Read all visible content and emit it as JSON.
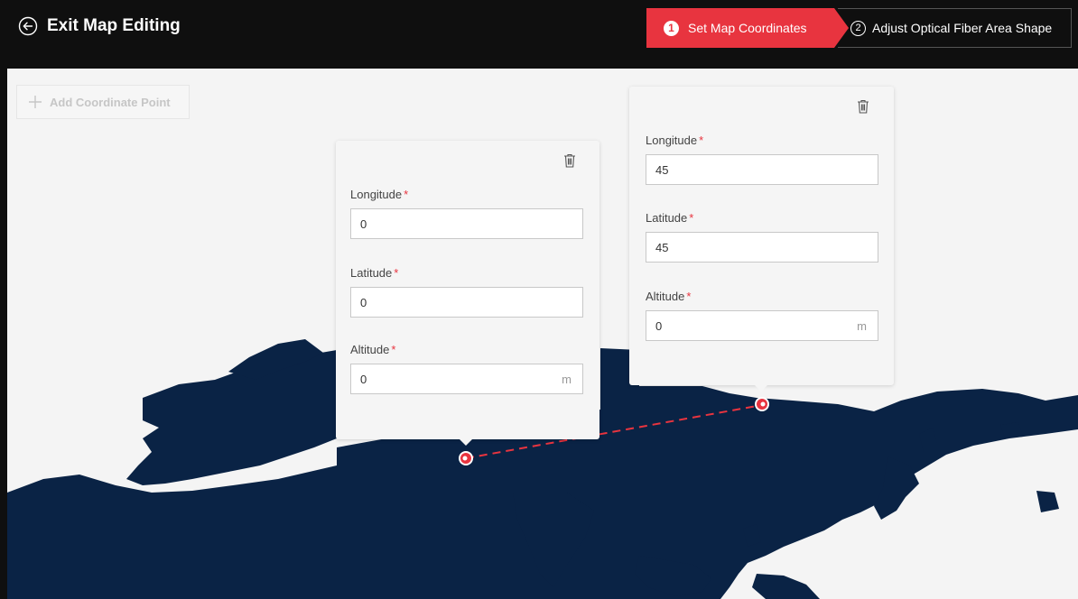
{
  "header": {
    "exit_label": "Exit Map Editing",
    "steps": [
      {
        "number": "1",
        "label": "Set Map Coordinates",
        "active": true
      },
      {
        "number": "2",
        "label": "Adjust Optical Fiber Area Shape",
        "active": false
      }
    ]
  },
  "toolbar": {
    "add_point_label": "Add Coordinate Point"
  },
  "points": [
    {
      "longitude_label": "Longitude",
      "longitude": "0",
      "latitude_label": "Latitude",
      "latitude": "0",
      "altitude_label": "Altitude",
      "altitude": "0",
      "unit": "m",
      "required_mark": "*"
    },
    {
      "longitude_label": "Longitude",
      "longitude": "45",
      "latitude_label": "Latitude",
      "latitude": "45",
      "altitude_label": "Altitude",
      "altitude": "0",
      "unit": "m",
      "required_mark": "*"
    }
  ],
  "colors": {
    "accent": "#e8343f",
    "map_land": "#0a2345",
    "map_bg": "#f4f4f4",
    "topbar": "#0f0f0f"
  },
  "icons": [
    "back-arrow-icon",
    "plus-icon",
    "trash-icon",
    "map-marker-icon"
  ]
}
